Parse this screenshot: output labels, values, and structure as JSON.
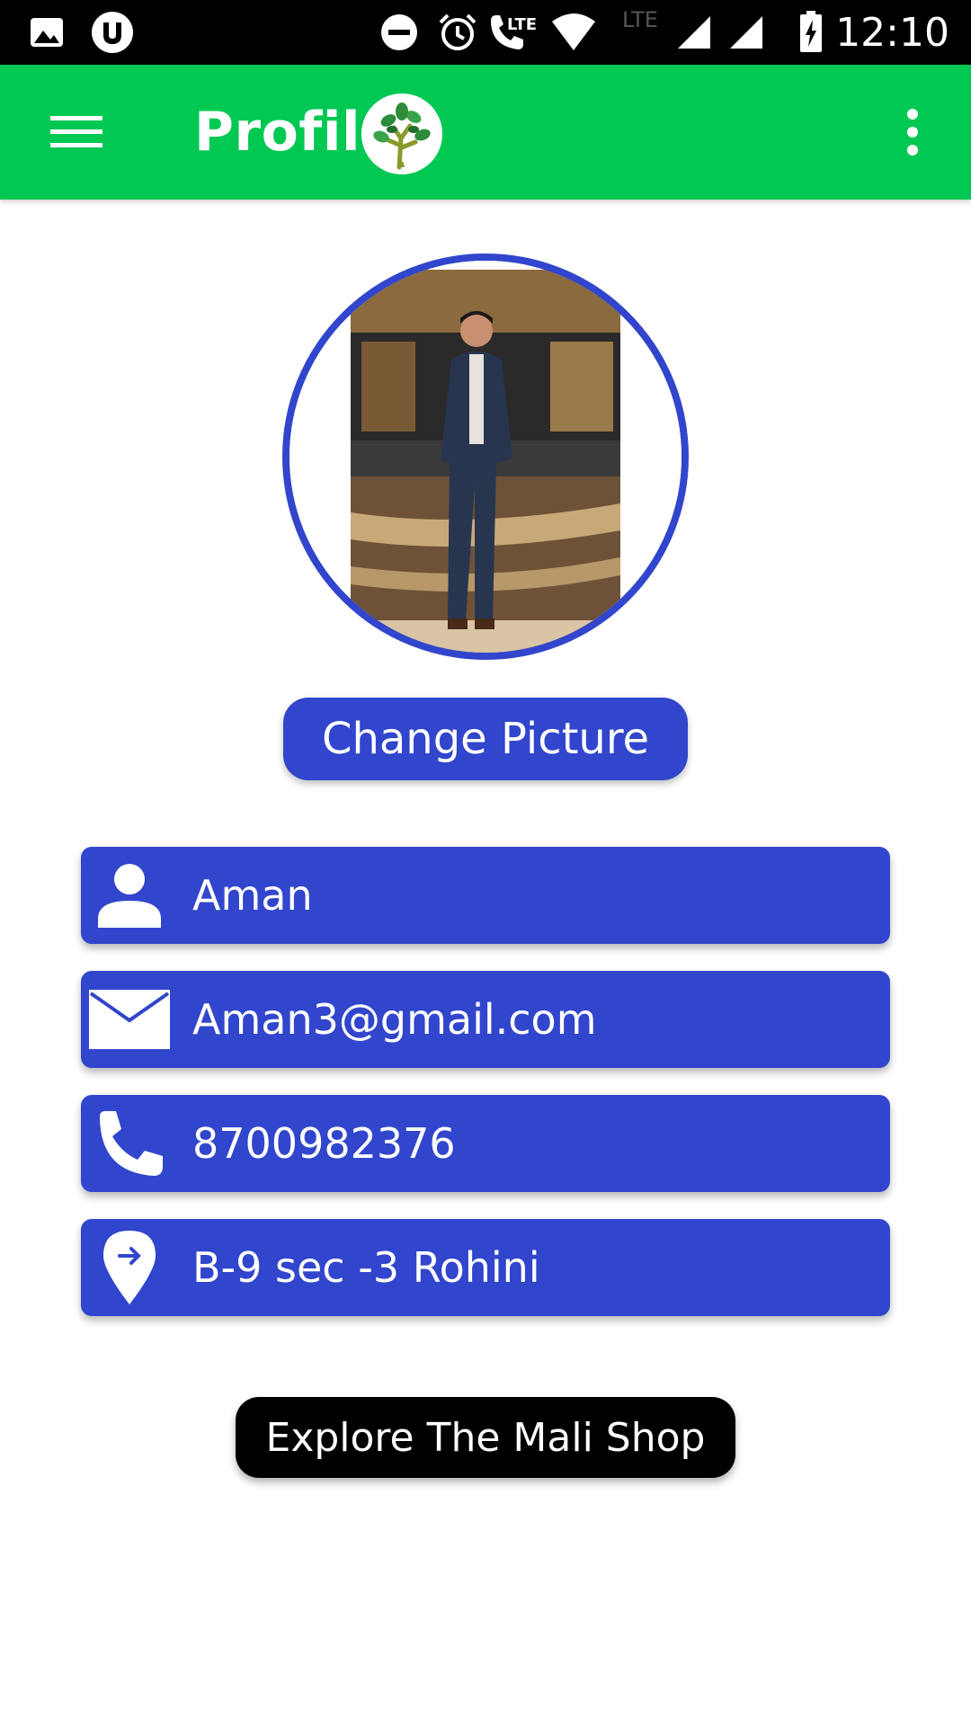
{
  "status_bar": {
    "time": "12:10",
    "icons": [
      "gallery-icon",
      "utorrent-icon",
      "do-not-disturb-icon",
      "alarm-icon",
      "volte-call-icon",
      "wifi-icon",
      "lte-signal-icon",
      "signal-icon",
      "battery-charging-icon"
    ],
    "lte_label": "LTE",
    "volte_label": "LTE"
  },
  "app_bar": {
    "title": "Profile",
    "background_color": "#00c853",
    "menu_icon": "hamburger-menu-icon",
    "overflow_icon": "more-vert-icon",
    "logo_icon": "tree-logo-icon"
  },
  "profile": {
    "avatar_icon": "profile-photo",
    "change_picture_label": "Change Picture",
    "name": "Aman",
    "email": "Aman3@gmail.com",
    "phone": "8700982376",
    "address": "B-9 sec -3 Rohini",
    "field_icons": {
      "name": "person-icon",
      "email": "mail-icon",
      "phone": "phone-icon",
      "address": "location-pin-icon"
    },
    "accent_color": "#3146cc"
  },
  "explore_label": "Explore The Mali Shop"
}
